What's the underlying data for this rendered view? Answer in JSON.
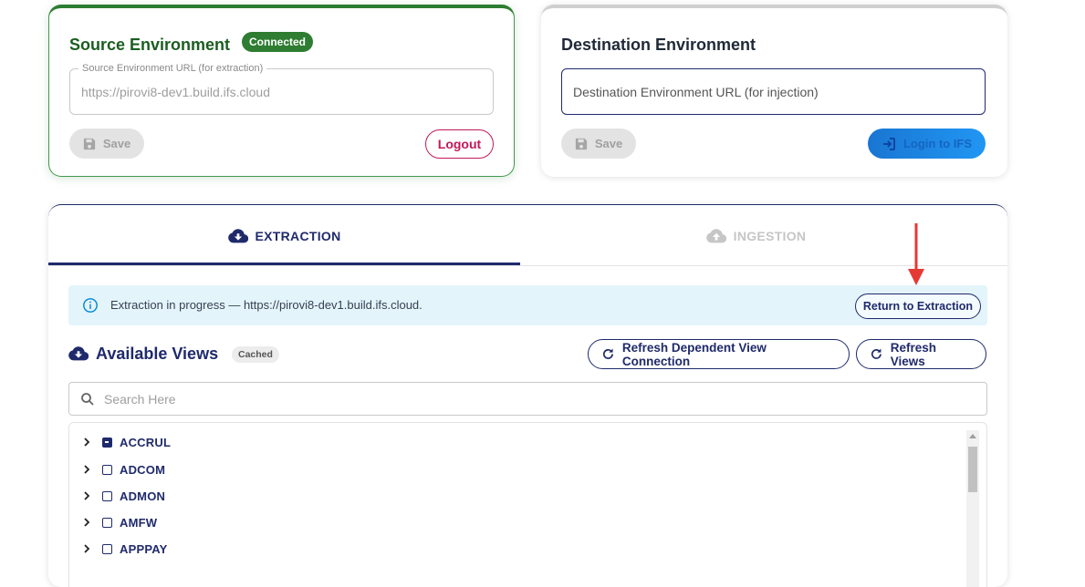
{
  "source": {
    "title": "Source Environment",
    "status_badge": "Connected",
    "url_label": "Source Environment URL (for extraction)",
    "url_value": "https://pirovi8-dev1.build.ifs.cloud",
    "save_label": "Save",
    "logout_label": "Logout"
  },
  "destination": {
    "title": "Destination Environment",
    "url_placeholder": "Destination Environment URL (for injection)",
    "save_label": "Save",
    "login_label": "Login to IFS"
  },
  "tabs": [
    {
      "label": "EXTRACTION",
      "icon": "cloud-download-icon",
      "active": true
    },
    {
      "label": "INGESTION",
      "icon": "cloud-upload-icon",
      "active": false
    }
  ],
  "info_bar": {
    "message": "Extraction in progress — https://pirovi8-dev1.build.ifs.cloud.",
    "return_label": "Return to Extraction"
  },
  "views": {
    "title": "Available Views",
    "cached_badge": "Cached",
    "refresh_dependent_label": "Refresh Dependent View Connection",
    "refresh_views_label": "Refresh Views",
    "search_placeholder": "Search Here",
    "items": [
      {
        "label": "ACCRUL",
        "state": "indeterminate"
      },
      {
        "label": "ADCOM",
        "state": "unchecked"
      },
      {
        "label": "ADMON",
        "state": "unchecked"
      },
      {
        "label": "AMFW",
        "state": "unchecked"
      },
      {
        "label": "APPPAY",
        "state": "unchecked"
      }
    ]
  },
  "colors": {
    "primary": "#1f2a6b",
    "connected_green": "#2e7d32",
    "logout_pink": "#c2185b",
    "login_blue": "#1e88e5",
    "info_bg": "#e3f4fb",
    "annotation_red": "#e53935"
  }
}
